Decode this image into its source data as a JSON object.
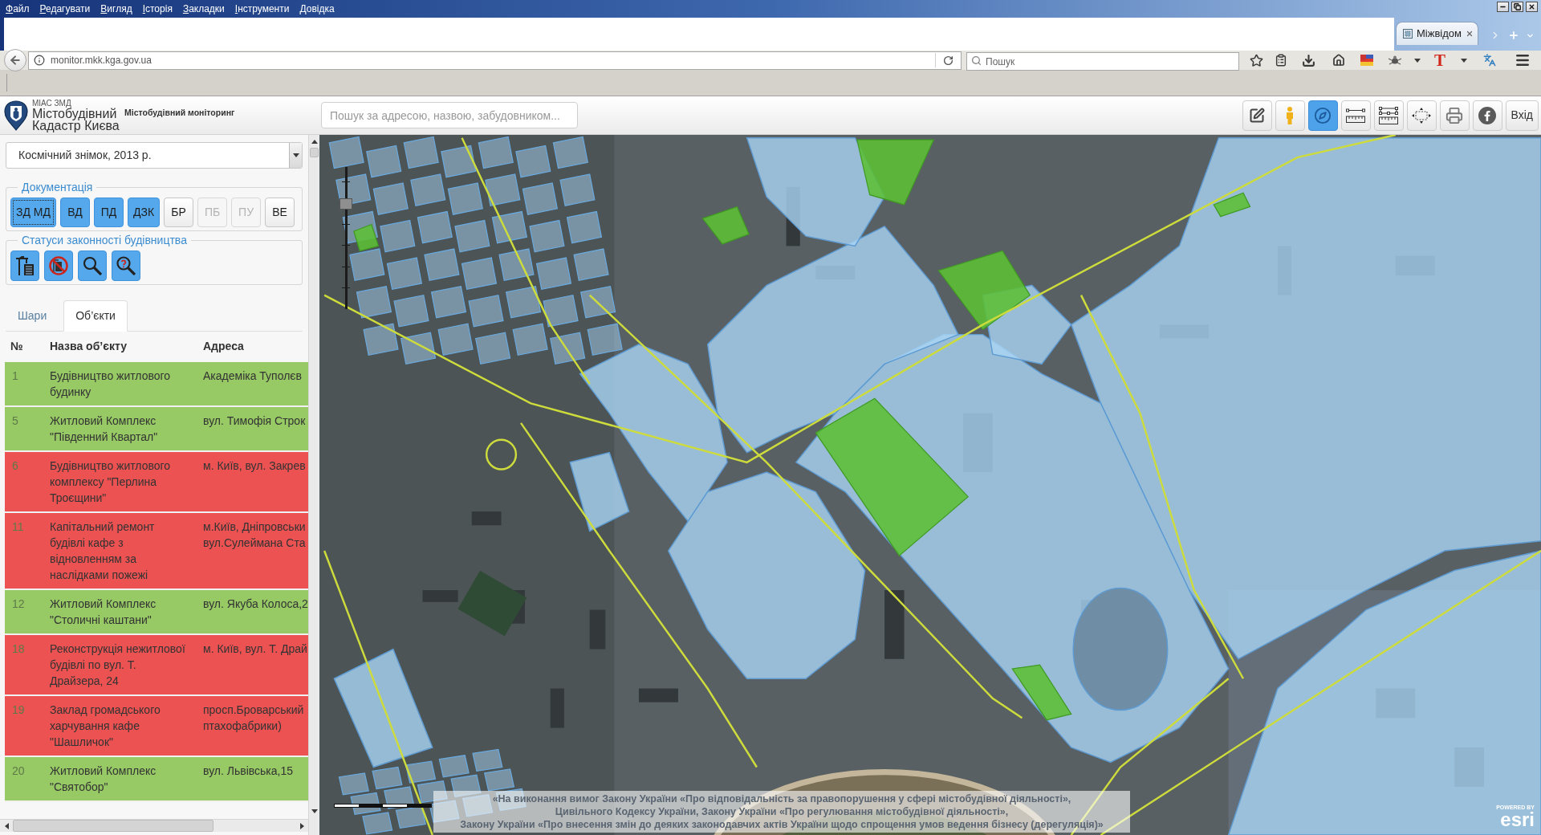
{
  "browser": {
    "menu": [
      "Файл",
      "Редагувати",
      "Вигляд",
      "Історія",
      "Закладки",
      "Інструменти",
      "Довідка"
    ],
    "tab": {
      "title": "Міжвідом",
      "selected": true
    },
    "url": "monitor.mkk.kga.gov.ua",
    "search": {
      "placeholder": "Пошук"
    },
    "extension_glyph": "T"
  },
  "header": {
    "org": "МІАС ЗМД",
    "title": [
      "Містобудівний",
      "Кадастр Києва"
    ],
    "subtitle": "Містобудівний моніторинг",
    "search": {
      "placeholder": "Пошук за адресою, назвою, забудовником..."
    },
    "tools": [
      {
        "kind": "edit",
        "selected": false
      },
      {
        "kind": "person",
        "selected": false
      },
      {
        "kind": "compass",
        "selected": true
      },
      {
        "kind": "ruler",
        "selected": false
      },
      {
        "kind": "area",
        "selected": false
      },
      {
        "kind": "extent",
        "selected": false
      },
      {
        "kind": "print",
        "selected": false
      },
      {
        "kind": "social",
        "selected": false
      },
      {
        "kind": "login",
        "label": "Вхід",
        "selected": false
      }
    ]
  },
  "sidebar": {
    "basemap": "Космічний знімок, 2013 р.",
    "documentation": {
      "legend": "Документація",
      "buttons": [
        {
          "label": "ЗД МД",
          "on": true,
          "disabled": false,
          "focused": true
        },
        {
          "label": "ВД",
          "on": true,
          "disabled": false,
          "focused": false
        },
        {
          "label": "ПД",
          "on": true,
          "disabled": false,
          "focused": false
        },
        {
          "label": "ДЗК",
          "on": true,
          "disabled": false,
          "focused": false
        },
        {
          "label": "БР",
          "on": false,
          "disabled": false,
          "focused": false
        },
        {
          "label": "ПБ",
          "on": false,
          "disabled": true,
          "focused": false
        },
        {
          "label": "ПУ",
          "on": false,
          "disabled": true,
          "focused": false
        },
        {
          "label": "ВЕ",
          "on": false,
          "disabled": false,
          "focused": false
        }
      ]
    },
    "statuses": {
      "legend": "Статуси законності будівництва",
      "buttons": [
        {
          "kind": "crane"
        },
        {
          "kind": "banned"
        },
        {
          "kind": "search"
        },
        {
          "kind": "question"
        }
      ]
    },
    "tabs": [
      {
        "label": "Шари",
        "selected": false
      },
      {
        "label": "Об’єкти",
        "selected": true
      }
    ],
    "table": {
      "columns": [
        "№",
        "Назва об’єкту",
        "Адреса"
      ],
      "rows": [
        {
          "number": "1",
          "name": [
            "Будівництво житлового",
            "будинку"
          ],
          "address": [
            "Академіка Туполєв"
          ],
          "color": "#97c965"
        },
        {
          "number": "5",
          "name": [
            "Житловий Комплекс",
            "\"Південний Квартал\""
          ],
          "address": [
            "вул. Тимофія Строк"
          ],
          "color": "#97c965"
        },
        {
          "number": "6",
          "name": [
            "Будівництво житлового",
            "комплексу \"Перлина",
            "Троєщини\""
          ],
          "address": [
            "м. Київ, вул. Закрев"
          ],
          "color": "#ec5252"
        },
        {
          "number": "11",
          "name": [
            "Капітальний ремонт",
            "будівлі кафе з",
            "відновленням за",
            "наслідками пожежі"
          ],
          "address": [
            "м.Київ, Дніпровськи",
            "вул.Сулеймана Ста"
          ],
          "color": "#ec5252"
        },
        {
          "number": "12",
          "name": [
            "Житловий Комплекс",
            "\"Столичні каштани\""
          ],
          "address": [
            "вул. Якуба Колоса,2"
          ],
          "color": "#97c965"
        },
        {
          "number": "18",
          "name": [
            "Реконструкція нежитлової",
            "будівлі по вул. Т.",
            "Драйзера, 24"
          ],
          "address": [
            "м. Київ, вул. Т. Драй"
          ],
          "color": "#ec5252"
        },
        {
          "number": "19",
          "name": [
            "Заклад громадського",
            "харчування кафе",
            "\"Шашличок\""
          ],
          "address": [
            "просп.Броварський",
            "птахофабрики)"
          ],
          "color": "#ec5252"
        },
        {
          "number": "20",
          "name": [
            "Житловий Комплекс",
            "\"Святобор\""
          ],
          "address": [
            "вул. Львівська,15"
          ],
          "color": "#97c965"
        }
      ]
    }
  },
  "map": {
    "zoom_slider": {
      "level": 0.76
    },
    "notice": [
      "«На виконання вимог Закону України «Про відповідальність за правопорушення у сфері містобудівної діяльності»,",
      "Цивільного Кодексу України, Закону України «Про регулювання містобудівної діяльності»,",
      "Закону України «Про внесення змін до деяких законодавчих актів України щодо спрощення умов ведення бізнесу (дерегуляція)»"
    ],
    "attribution": {
      "caption": "POWERED BY",
      "brand": "esri"
    }
  }
}
